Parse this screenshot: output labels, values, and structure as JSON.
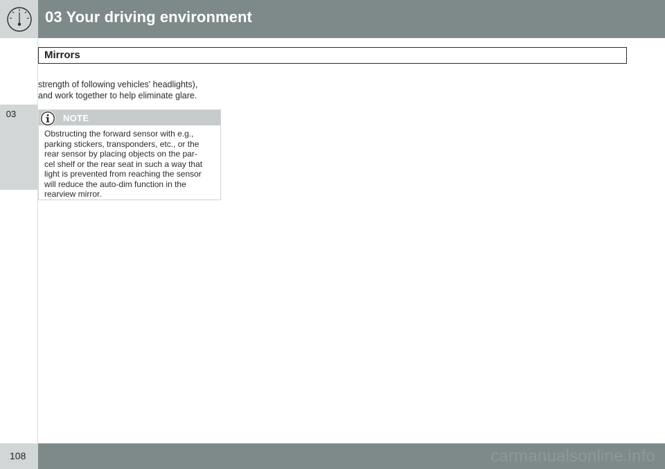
{
  "header": {
    "chapter_title": "03 Your driving environment",
    "icon": "gauge-icon"
  },
  "sidebar": {
    "chapter_tab": "03"
  },
  "section": {
    "heading": "Mirrors"
  },
  "body": {
    "lines": [
      "strength of following vehicles' headlights),",
      "and work together to help eliminate glare."
    ]
  },
  "note": {
    "title": "NOTE",
    "icon": "info-icon",
    "lines": [
      "Obstructing the forward sensor with e.g.,",
      "parking stickers, transponders, etc., or the",
      "rear sensor by placing objects on the par-",
      "cel shelf or the rear seat in such a way that",
      "light is prevented from reaching the sensor",
      "will reduce the auto-dim function in the",
      "rearview mirror."
    ]
  },
  "footer": {
    "page_number": "108",
    "watermark": "carmanualsonline.info"
  }
}
